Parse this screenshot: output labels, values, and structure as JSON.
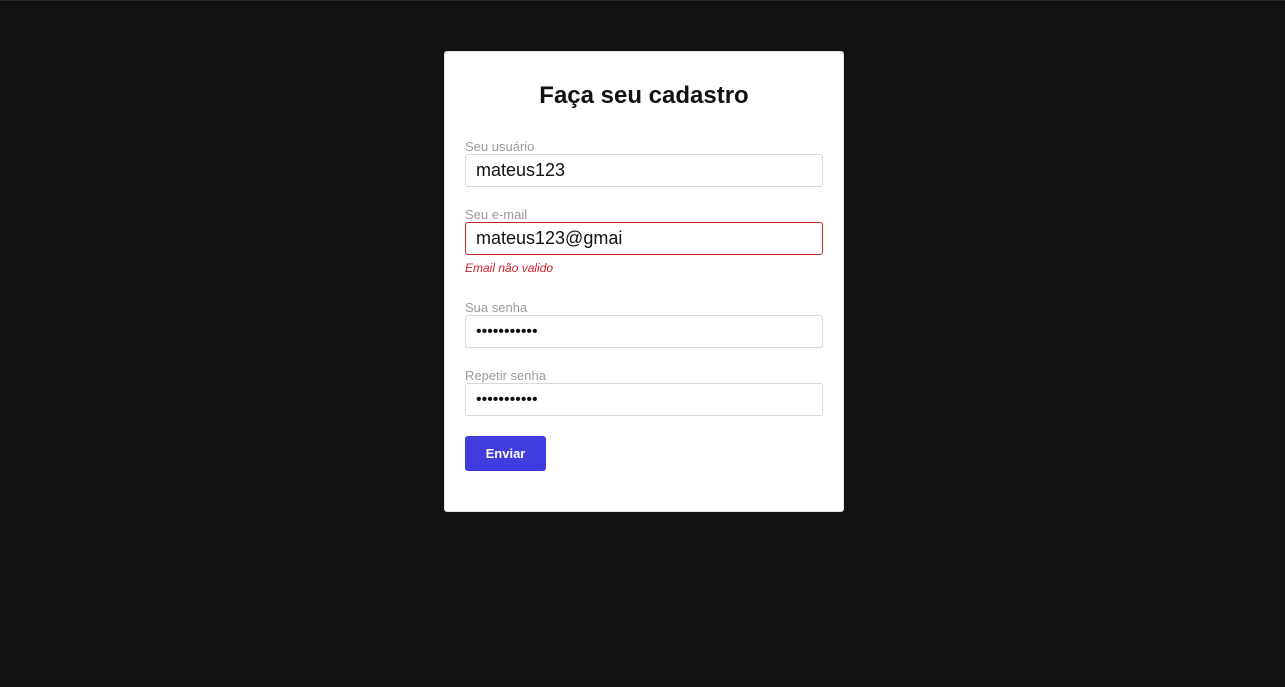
{
  "form": {
    "title": "Faça seu cadastro",
    "fields": [
      {
        "label": "Seu usuário",
        "value": "mateus123",
        "type": "text"
      },
      {
        "label": "Seu e-mail",
        "value": "mateus123@gmai",
        "type": "email",
        "error": "Email não valido"
      },
      {
        "label": "Sua senha",
        "value": "12345678901",
        "type": "password"
      },
      {
        "label": "Repetir senha",
        "value": "12345678901",
        "type": "password"
      }
    ],
    "submit_label": "Enviar"
  },
  "colors": {
    "background": "#121212",
    "card": "#ffffff",
    "button": "#413cdd",
    "error": "#d21f2b",
    "invalid_border": "#c22a2a"
  }
}
